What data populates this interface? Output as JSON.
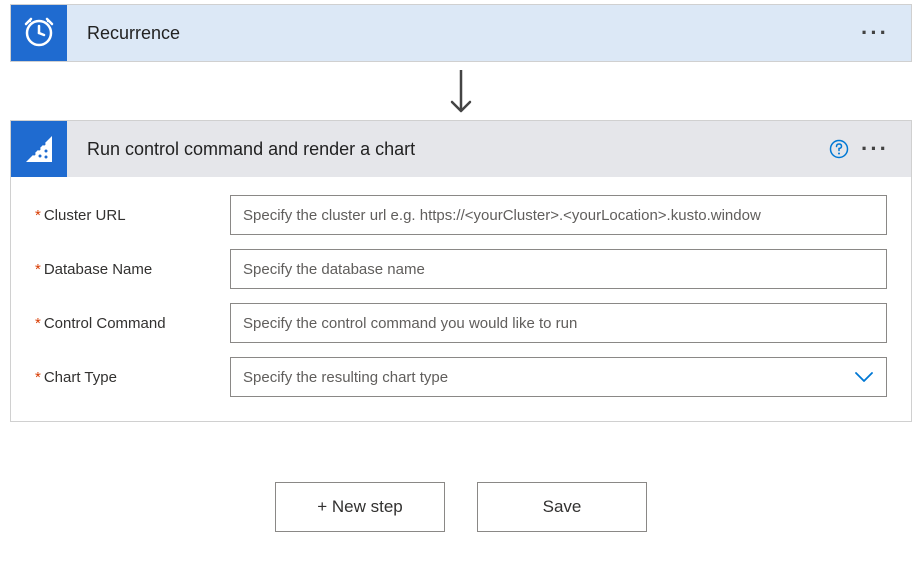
{
  "recurrence": {
    "title": "Recurrence"
  },
  "action": {
    "title": "Run control command and render a chart",
    "fields": {
      "cluster_url": {
        "label": "Cluster URL",
        "placeholder": "Specify the cluster url e.g. https://<yourCluster>.<yourLocation>.kusto.window"
      },
      "database_name": {
        "label": "Database Name",
        "placeholder": "Specify the database name"
      },
      "control_command": {
        "label": "Control Command",
        "placeholder": "Specify the control command you would like to run"
      },
      "chart_type": {
        "label": "Chart Type",
        "placeholder": "Specify the resulting chart type"
      }
    }
  },
  "footer": {
    "new_step": "+ New step",
    "save": "Save"
  }
}
